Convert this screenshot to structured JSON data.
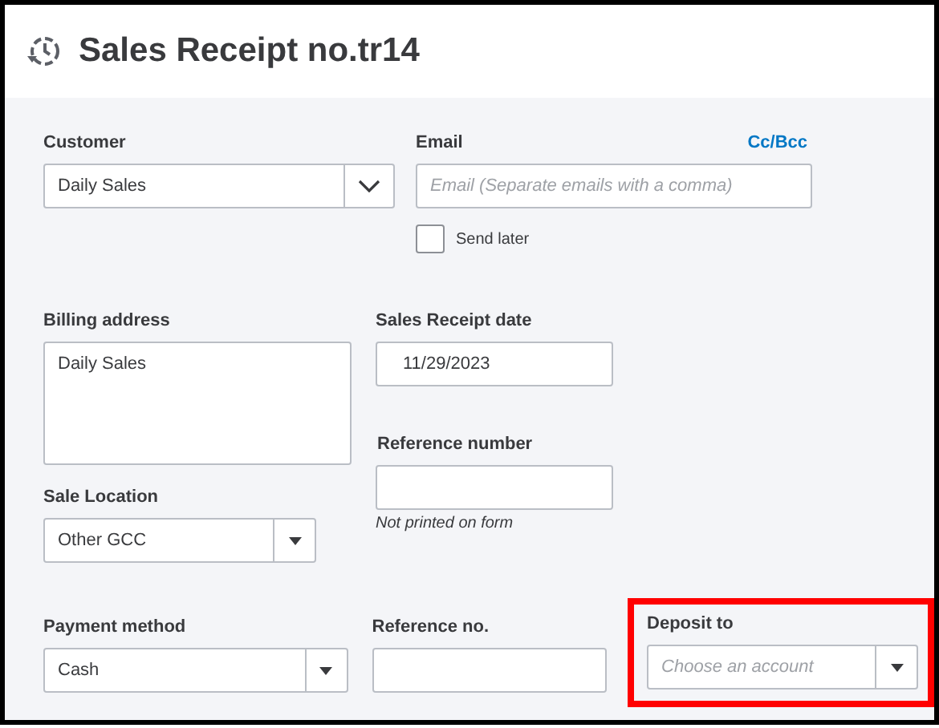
{
  "title": "Sales Receipt no.tr14",
  "customer": {
    "label": "Customer",
    "value": "Daily Sales"
  },
  "email": {
    "label": "Email",
    "link": "Cc/Bcc",
    "placeholder": "Email (Separate emails with a comma)"
  },
  "send_later": {
    "label": "Send later",
    "checked": false
  },
  "billing_address": {
    "label": "Billing address",
    "value": "Daily Sales"
  },
  "sales_receipt_date": {
    "label": "Sales Receipt date",
    "value": "11/29/2023"
  },
  "reference_number": {
    "label": "Reference number",
    "hint": "Not printed on form"
  },
  "sale_location": {
    "label": "Sale Location",
    "value": "Other GCC"
  },
  "payment_method": {
    "label": "Payment method",
    "value": "Cash"
  },
  "reference_no": {
    "label": "Reference no."
  },
  "deposit_to": {
    "label": "Deposit to",
    "placeholder": "Choose an account",
    "highlighted": true
  }
}
